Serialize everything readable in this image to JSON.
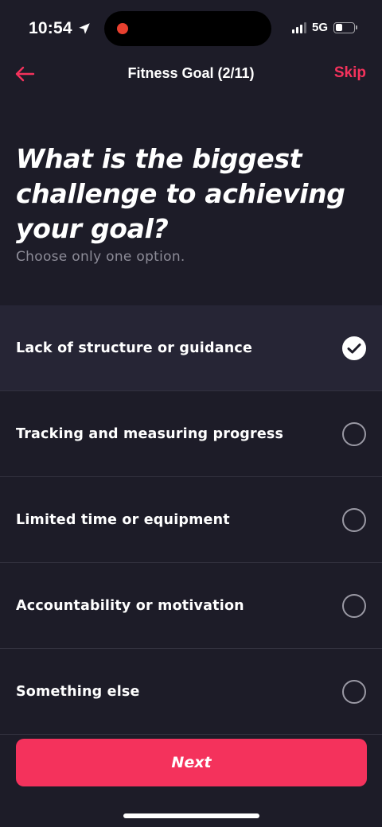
{
  "status_bar": {
    "time": "10:54",
    "network": "5G",
    "recording_color": "#e8402f"
  },
  "header": {
    "title": "Fitness Goal (2/11)",
    "skip_label": "Skip",
    "back_icon": "arrow-left-icon"
  },
  "question": {
    "title": "What is the biggest challenge to achieving your goal?",
    "subtitle": "Choose only one option."
  },
  "options": [
    {
      "label": "Lack of structure or guidance",
      "selected": true
    },
    {
      "label": "Tracking and measuring progress",
      "selected": false
    },
    {
      "label": "Limited time or equipment",
      "selected": false
    },
    {
      "label": "Accountability or motivation",
      "selected": false
    },
    {
      "label": "Something else",
      "selected": false
    }
  ],
  "footer": {
    "next_label": "Next"
  },
  "colors": {
    "accent": "#f4325c",
    "background": "#1d1c28",
    "selected_row": "#262535",
    "muted_text": "#8d8c98"
  }
}
